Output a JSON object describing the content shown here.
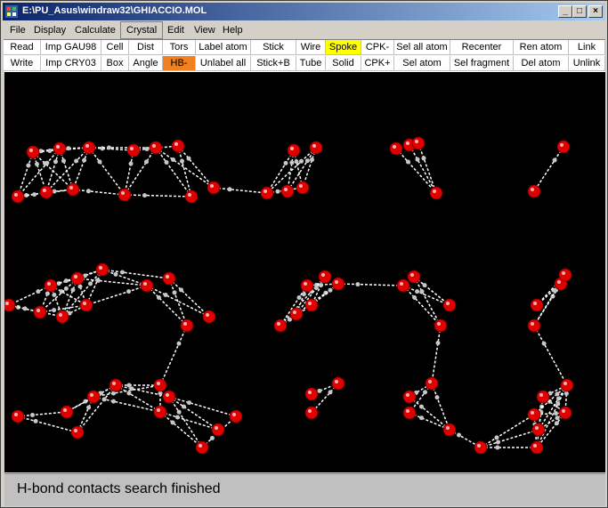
{
  "window": {
    "title": "E:\\PU_Asus\\windraw32\\GHIACCIO.MOL",
    "minimize_label": "_",
    "maximize_label": "□",
    "close_label": "×"
  },
  "menu": {
    "items": [
      "File",
      "Display",
      "Calculate",
      "Crystal",
      "Edit",
      "View",
      "Help"
    ],
    "active": "Crystal"
  },
  "toolbar": {
    "row1": [
      "Read",
      "Imp GAU98",
      "Cell",
      "Dist",
      "Tors",
      "Label atom",
      "Stick",
      "Wire",
      "Spoke",
      "CPK-",
      "Sel all atom",
      "Recenter",
      "Ren atom",
      "Link"
    ],
    "row2": [
      "Write",
      "Imp CRY03",
      "Box",
      "Angle",
      "HB-",
      "Unlabel all",
      "Stick+B",
      "Tube",
      "Solid",
      "CPK+",
      "Sel atom",
      "Sel fragment",
      "Del atom",
      "Unlink"
    ],
    "highlight_spoke": "#ffff00",
    "highlight_hb": "#f08020"
  },
  "viewer": {
    "background": "#000000",
    "oxygen_color": "#e00000",
    "hydrogen_color": "#c8c8c8",
    "bond_color": "#ffffff"
  },
  "status": {
    "message": "H-bond contacts search finished"
  }
}
